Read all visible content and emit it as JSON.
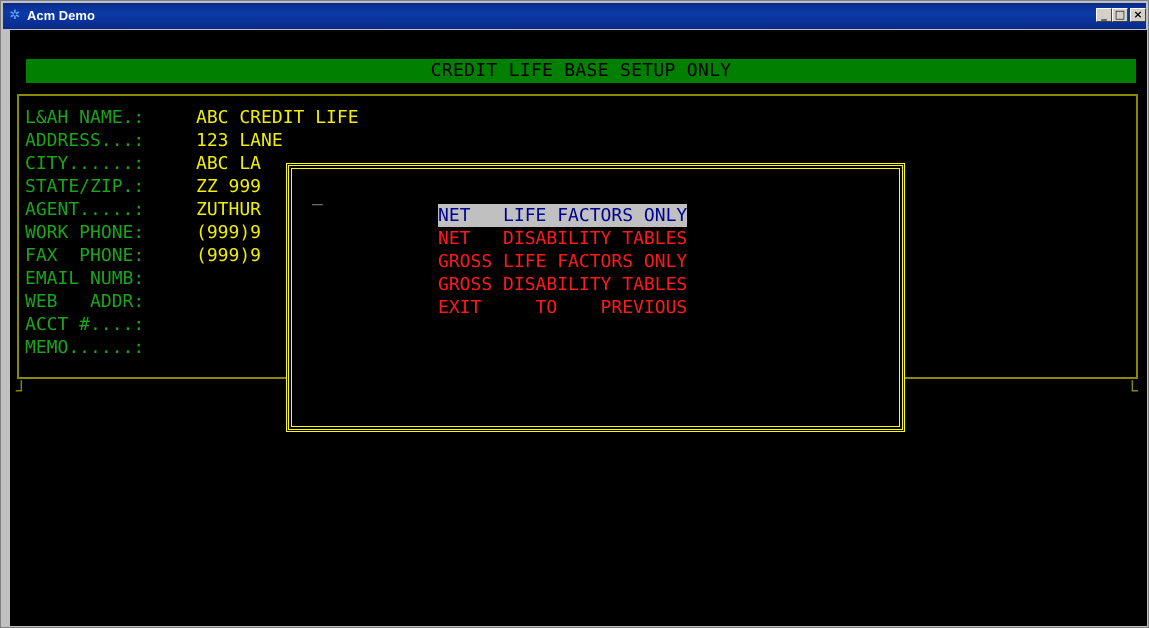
{
  "window": {
    "title": "Acm Demo",
    "controls": {
      "minimize": "_",
      "maximize": "□",
      "close": "×"
    }
  },
  "colors": {
    "banner_bg": "#007f00",
    "label_green": "#1aa51a",
    "value_yellow": "#f0f000",
    "menu_red": "#ff1a1a",
    "selected_bg": "#c0c0c0",
    "selected_fg": "#000090",
    "border_olive": "#8a8a00",
    "dialog_border": "#ffff00"
  },
  "banner": {
    "text": "CREDIT LIFE BASE SETUP ONLY"
  },
  "form": {
    "fields": [
      {
        "label": "L&AH NAME.:",
        "value": "ABC CREDIT LIFE"
      },
      {
        "label": "ADDRESS...:",
        "value": "123 LANE"
      },
      {
        "label": "CITY......:",
        "value": "ABC LA"
      },
      {
        "label": "STATE/ZIP.:",
        "value": "ZZ 999"
      },
      {
        "label": "AGENT.....:",
        "value": "ZUTHUR"
      },
      {
        "label": "WORK PHONE:",
        "value": "(999)9"
      },
      {
        "label": "FAX  PHONE:",
        "value": "(999)9"
      },
      {
        "label": "EMAIL NUMB:",
        "value": ""
      },
      {
        "label": "WEB   ADDR:",
        "value": ""
      },
      {
        "label": "ACCT #....:",
        "value": ""
      },
      {
        "label": "MEMO......:",
        "value": ""
      }
    ]
  },
  "dialog": {
    "cursor": "_",
    "menu": [
      {
        "label": "NET   LIFE FACTORS ONLY",
        "selected": true
      },
      {
        "label": "NET   DISABILITY TABLES",
        "selected": false
      },
      {
        "label": "GROSS LIFE FACTORS ONLY",
        "selected": false
      },
      {
        "label": "GROSS DISABILITY TABLES",
        "selected": false
      },
      {
        "label": "EXIT     TO    PREVIOUS",
        "selected": false
      }
    ]
  }
}
